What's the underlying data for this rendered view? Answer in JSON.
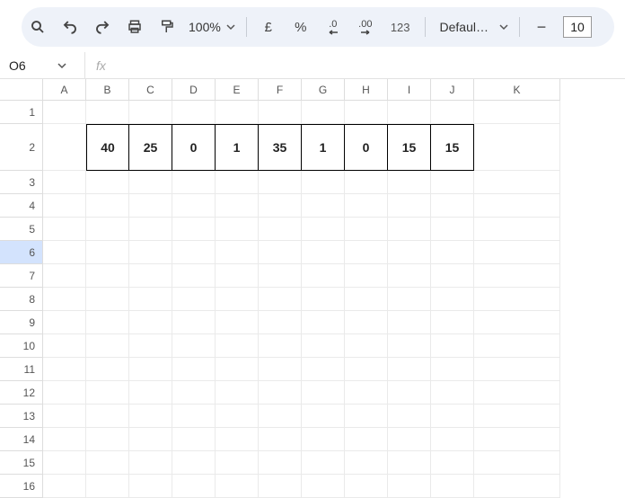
{
  "toolbar": {
    "zoom": "100%",
    "currency": "£",
    "percent": "%",
    "dec_dec": ".0",
    "dec_inc": ".00",
    "num_format": "123",
    "font_name": "Defaul…",
    "minus": "−",
    "font_size": "10"
  },
  "namebox": {
    "value": "O6",
    "fx": "fx"
  },
  "columns": [
    "A",
    "B",
    "C",
    "D",
    "E",
    "F",
    "G",
    "H",
    "I",
    "J",
    "K"
  ],
  "rows": [
    "1",
    "2",
    "3",
    "4",
    "5",
    "6",
    "7",
    "8",
    "9",
    "10",
    "11",
    "12",
    "13",
    "14",
    "15",
    "16"
  ],
  "selected_row": 6,
  "data_row": {
    "cells": [
      "40",
      "25",
      "0",
      "1",
      "35",
      "1",
      "0",
      "15",
      "15"
    ]
  }
}
